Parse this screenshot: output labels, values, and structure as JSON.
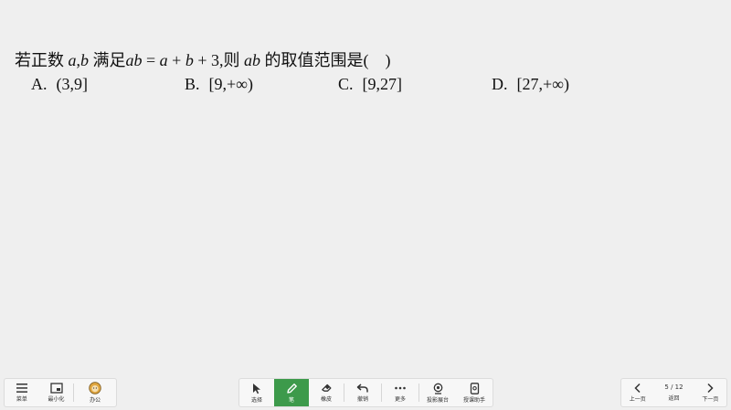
{
  "question": {
    "p1": "若正数 ",
    "v1": "a",
    "comma1": ",",
    "v2": "b",
    "p2": " 满足",
    "v3": "ab",
    "p3": " = ",
    "v4": "a",
    "p4": " + ",
    "v5": "b",
    "p5": " + 3,则 ",
    "v6": "ab",
    "p6": " 的取值范围是(　)"
  },
  "options": [
    {
      "letter": "A.",
      "text": "(3,9]"
    },
    {
      "letter": "B.",
      "text": "[9,+∞)"
    },
    {
      "letter": "C.",
      "text": "[9,27]"
    },
    {
      "letter": "D.",
      "text": "[27,+∞)"
    }
  ],
  "toolbar_left": [
    {
      "label": "菜单",
      "icon": "menu-icon"
    },
    {
      "label": "最小化",
      "icon": "minimize-icon"
    },
    {
      "label": "办公",
      "icon": "avatar-icon"
    }
  ],
  "toolbar_center": [
    {
      "label": "选择",
      "icon": "cursor-icon"
    },
    {
      "label": "笔",
      "icon": "pen-icon"
    },
    {
      "label": "橡皮",
      "icon": "eraser-icon"
    },
    {
      "label": "撤销",
      "icon": "undo-icon"
    },
    {
      "label": "更多",
      "icon": "more-icon"
    },
    {
      "label": "投影展台",
      "icon": "camera-icon"
    },
    {
      "label": "授课助手",
      "icon": "phone-icon"
    }
  ],
  "toolbar_right": {
    "prev_label": "上一页",
    "page_indicator": "5 / 12",
    "return_label": "返回",
    "next_label": "下一页"
  },
  "colors": {
    "background": "#efefef",
    "active_tool": "#3d9a4b"
  }
}
